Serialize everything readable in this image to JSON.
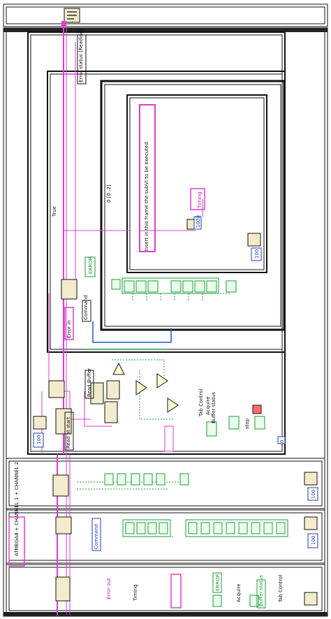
{
  "diagram": {
    "rotated_labels": {
      "error_status_reading": "Error status (Reading)",
      "case_selector": "True",
      "sequence_selector": "0 [0..2]",
      "insert_note": "Insert in this frame the subVI to be executed.",
      "timing": "Timing",
      "error": "ERROR",
      "error_in": "Error in",
      "command": "Command",
      "read_buffer": "Read Buffer",
      "read_at_start": "Read at start",
      "tab_control": "Tab Control",
      "acquire": "Acquire",
      "buffer_status": "Buffer status",
      "stop": "stop",
      "atmega_list": "ATMEGA8\n+ CHANNEL 1\n+ CHANNEL 2",
      "command_lower": "Command",
      "timing_lower": "Timing",
      "error_lower": "ERROR",
      "acquire_lower": "Acquire",
      "buffer_status_lower": "Buffer status",
      "tab_control_lower": "Tab Control",
      "error_out_lower": "Error out"
    },
    "numbers": {
      "wait_ms": "100",
      "wait_ms_1": "100",
      "wait_ms_2": "100",
      "wait_ms_3": "100",
      "loop_count": "0",
      "const_1000": "1000"
    },
    "colors": {
      "frame": "#111111",
      "pink_wire": "#e23bd4",
      "green_wire": "#1e9a3a",
      "blue_wire": "#2255cc",
      "icon_fill": "#f2eccc",
      "numeric_blue": "#1f3bbf"
    }
  }
}
